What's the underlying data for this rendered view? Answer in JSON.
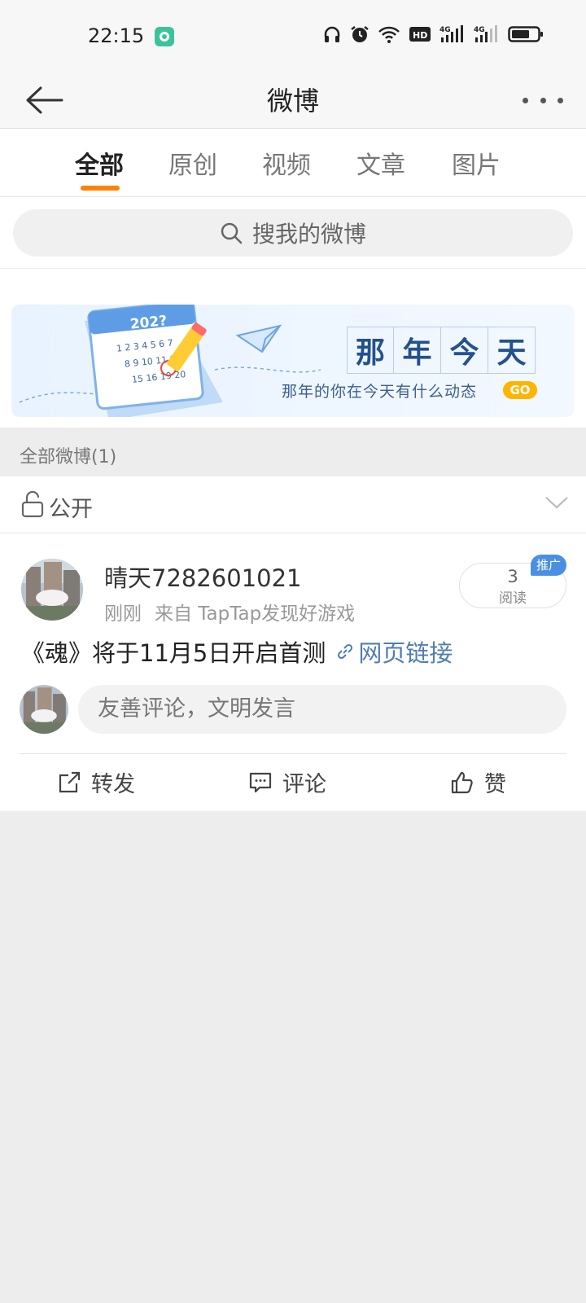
{
  "status_bar": {
    "time": "22:15",
    "icons": [
      "app-notification-icon",
      "headphones-icon",
      "alarm-icon",
      "wifi-icon",
      "hd-icon",
      "signal-4g-icon",
      "signal-4g-icon",
      "battery-icon"
    ]
  },
  "nav": {
    "title": "微博",
    "back_icon": "back-arrow-icon",
    "more_icon": "more-icon"
  },
  "tabs": [
    {
      "label": "全部",
      "active": true
    },
    {
      "label": "原创",
      "active": false
    },
    {
      "label": "视频",
      "active": false
    },
    {
      "label": "文章",
      "active": false
    },
    {
      "label": "图片",
      "active": false
    }
  ],
  "colors": {
    "accent": "#ff8200",
    "link": "#507daf",
    "badge": "#4a90e2"
  },
  "search": {
    "placeholder": "搜我的微博"
  },
  "banner": {
    "title_chars": [
      "那",
      "年",
      "今",
      "天"
    ],
    "subtitle": "那年的你在今天有什么动态",
    "go_label": "GO",
    "calendar_year": "202?"
  },
  "section": {
    "label": "全部微博(1)"
  },
  "visibility": {
    "label": "公开"
  },
  "post": {
    "username": "晴天7282601021",
    "time": "刚刚",
    "source": "来自 TapTap发现好游戏",
    "read_count": "3",
    "read_label": "阅读",
    "promo_badge": "推广",
    "text": "《魂》将于11月5日开启首测",
    "link_label": "网页链接",
    "comment_placeholder": "友善评论，文明发言"
  },
  "actions": {
    "repost": "转发",
    "comment": "评论",
    "like": "赞"
  }
}
